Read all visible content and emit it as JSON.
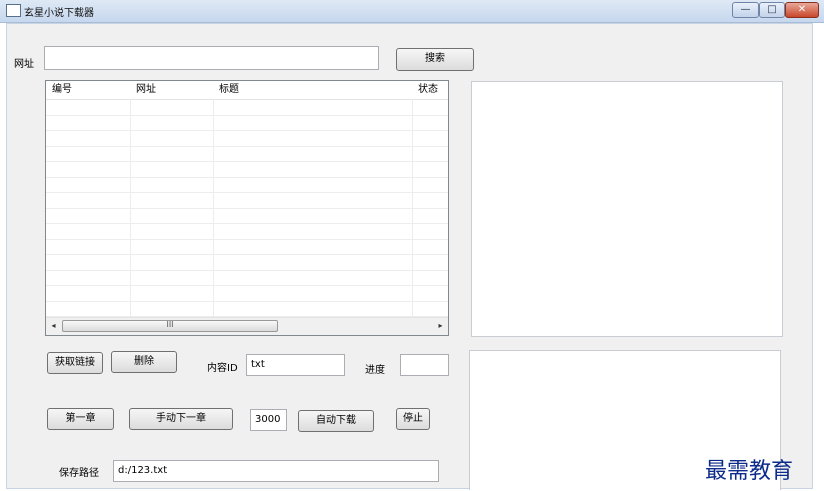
{
  "window": {
    "title": "玄星小说下载器",
    "minimize_glyph": "—",
    "maximize_glyph": "□",
    "close_glyph": "✕"
  },
  "url_row": {
    "label": "网址",
    "value": "",
    "search_label": "搜索"
  },
  "table": {
    "columns": [
      "编号",
      "网址",
      "标题",
      "状态"
    ],
    "rows": [],
    "scroll_left": "◂",
    "scroll_right": "▸",
    "thumb_grip": "III"
  },
  "actions": {
    "get_links_label": "获取链接",
    "delete_label": "删除",
    "content_id_label": "内容ID",
    "content_id_value": "txt",
    "progress_label": "进度",
    "progress_value": "",
    "first_chapter_label": "第一章",
    "manual_next_label": "手动下一章",
    "interval_value": "3000",
    "auto_download_label": "自动下载",
    "stop_label": "停止",
    "save_path_label": "保存路径",
    "save_path_value": "d:/123.txt"
  },
  "watermark": "最需教育"
}
